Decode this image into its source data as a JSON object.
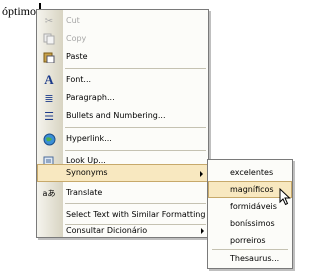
{
  "document": {
    "word": "óptimos"
  },
  "context_menu": {
    "items": [
      {
        "label": "Cut",
        "icon": "scissors-icon",
        "disabled": true
      },
      {
        "label": "Copy",
        "icon": "copy-icon",
        "disabled": true
      },
      {
        "label": "Paste",
        "icon": "paste-icon",
        "disabled": false
      },
      {
        "label": "Font...",
        "icon": "font-icon",
        "disabled": false
      },
      {
        "label": "Paragraph...",
        "icon": "paragraph-icon",
        "disabled": false
      },
      {
        "label": "Bullets and Numbering...",
        "icon": "bullets-icon",
        "disabled": false
      },
      {
        "label": "Hyperlink...",
        "icon": "hyperlink-icon",
        "disabled": false
      },
      {
        "label": "Look Up...",
        "icon": "lookup-icon",
        "disabled": false
      },
      {
        "label": "Synonyms",
        "icon": "",
        "disabled": false,
        "submenu": true,
        "highlighted": true
      },
      {
        "label": "Translate",
        "icon": "translate-icon",
        "disabled": false
      },
      {
        "label": "Select Text with Similar Formatting",
        "icon": "",
        "disabled": false
      },
      {
        "label": "Consultar Dicionário",
        "icon": "",
        "disabled": false,
        "submenu": true
      }
    ]
  },
  "synonyms_submenu": {
    "items": [
      {
        "label": "excelentes"
      },
      {
        "label": "magníficos",
        "selected": true
      },
      {
        "label": "formidáveis"
      },
      {
        "label": "boníssimos"
      },
      {
        "label": "porreiros"
      },
      {
        "label": "Thesaurus..."
      }
    ]
  },
  "colors": {
    "highlight": "#f8e8c0",
    "highlight_border": "#c7a96b",
    "disabled_text": "#a6a6a6"
  }
}
